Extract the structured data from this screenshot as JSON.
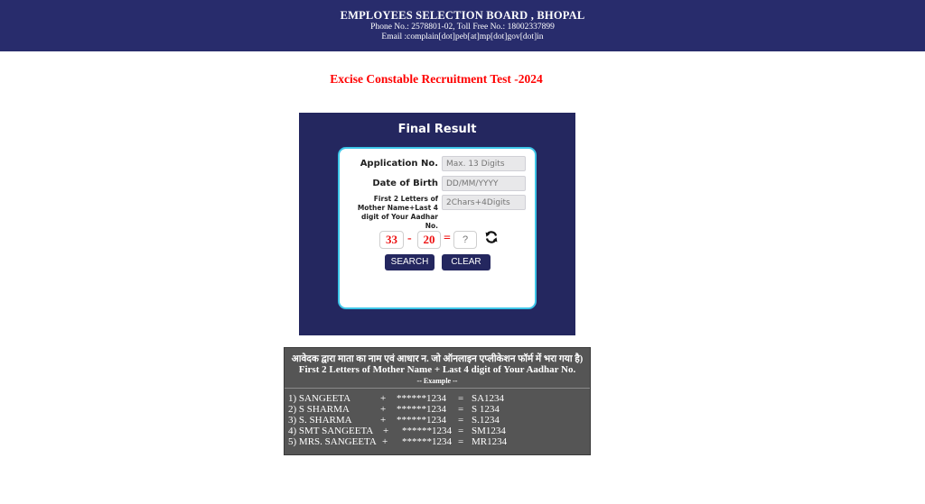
{
  "header": {
    "title": "EMPLOYEES SELECTION BOARD , BHOPAL",
    "phone": "Phone No.: 2578801-02, Toll Free No.: 18002337899",
    "email": "Email :complain[dot]peb[at]mp[dot]gov[dot]in"
  },
  "test_title": "Excise Constable Recruitment Test -2024",
  "form": {
    "title": "Final Result",
    "application_label": "Application No.",
    "application_placeholder": "Max. 13 Digits",
    "dob_label": "Date of Birth",
    "dob_placeholder": "DD/MM/YYYY",
    "mother_label_lines": [
      "First 2 Letters of",
      "Mother Name+Last 4",
      "digit of Your Aadhar",
      "No."
    ],
    "mother_placeholder": "2Chars+4Digits",
    "captcha": {
      "a": "33",
      "op": "-",
      "b": "20",
      "eq": "=",
      "placeholder": "?"
    },
    "search_label": "SEARCH",
    "clear_label": "CLEAR"
  },
  "info": {
    "hindi": "आवेदक द्वारा माता का नाम  एवं आधार न. जो ऑनलाइन एप्लीकेशन फॉर्म में भरा गया है)",
    "english": "First 2 Letters of Mother Name + Last 4 digit of Your Aadhar No.",
    "example": "-- Example --",
    "rows": [
      {
        "name": "1)  SANGEETA",
        "plus": "+",
        "digits": "******1234",
        "eq": "=",
        "result": "SA1234"
      },
      {
        "name": "2)  S SHARMA",
        "plus": "+",
        "digits": "******1234",
        "eq": "=",
        "result": "S 1234"
      },
      {
        "name": "3)  S. SHARMA",
        "plus": "+",
        "digits": "******1234",
        "eq": "=",
        "result": "S.1234"
      },
      {
        "name": "4) SMT SANGEETA",
        "plus": "+",
        "digits": "******1234",
        "eq": "=",
        "result": "SM1234"
      },
      {
        "name": "5) MRS. SANGEETA",
        "plus": "+",
        "digits": "******1234",
        "eq": "=",
        "result": "MR1234"
      }
    ]
  },
  "colors": {
    "header_bg": "#282c6c",
    "panel_bg": "#24275f",
    "card_border": "#3dc6e8",
    "captcha_red": "#ee1111",
    "title_red": "#ff0000",
    "info_bg": "#555555"
  },
  "icons": {
    "refresh": "refresh-icon"
  }
}
